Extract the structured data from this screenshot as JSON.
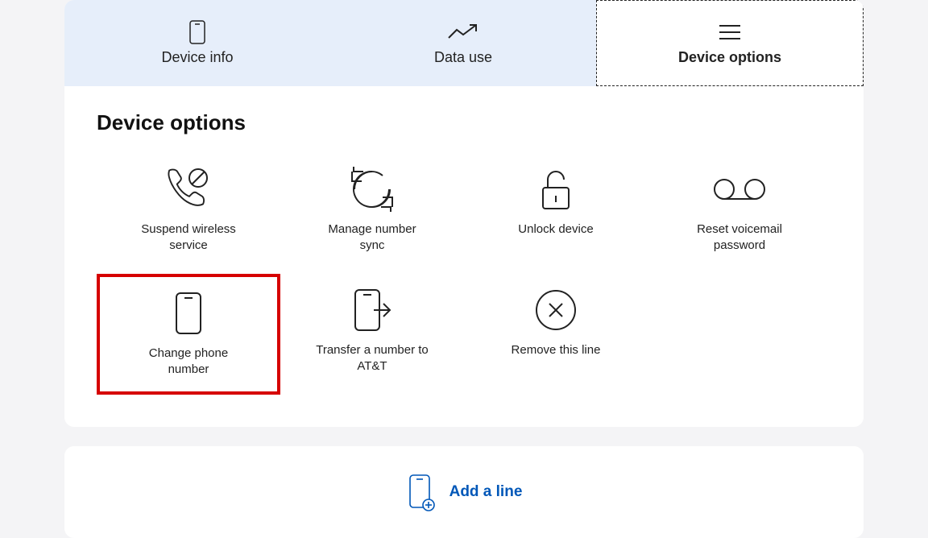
{
  "tabs": [
    {
      "label": "Device info"
    },
    {
      "label": "Data use"
    },
    {
      "label": "Device options"
    }
  ],
  "section_title": "Device options",
  "options": [
    {
      "label": "Suspend wireless service"
    },
    {
      "label": "Manage number sync"
    },
    {
      "label": "Unlock device"
    },
    {
      "label": "Reset voicemail password"
    },
    {
      "label": "Change phone number"
    },
    {
      "label": "Transfer a number to AT&T"
    },
    {
      "label": "Remove this line"
    }
  ],
  "add_line": {
    "label": "Add a line"
  },
  "colors": {
    "accent": "#0057b8",
    "highlight": "#d60000",
    "inactive_tab": "#e6eefa"
  }
}
